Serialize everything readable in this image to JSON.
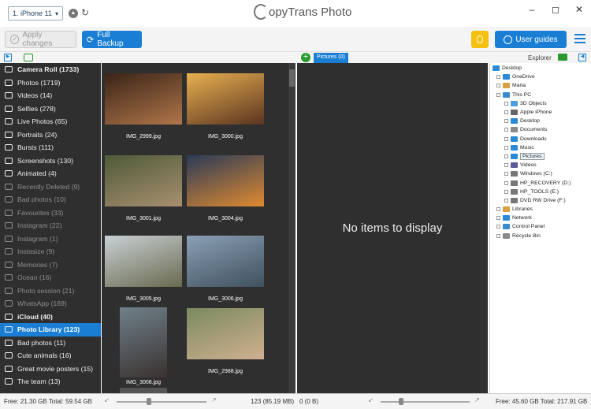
{
  "device": {
    "label": "1. iPhone 11"
  },
  "app": {
    "title_text": "opyTrans Photo"
  },
  "toolbar": {
    "apply_label": "Apply changes",
    "backup_label": "Full Backup",
    "guides_label": "User guides"
  },
  "panels": {
    "pictures_tab": "Pictures (0)",
    "explorer_label": "Explorer"
  },
  "sidebar": {
    "items": [
      {
        "label": "Camera Roll (1733)",
        "kind": "header"
      },
      {
        "label": "Photos (1719)",
        "kind": "normal"
      },
      {
        "label": "Videos (14)",
        "kind": "normal"
      },
      {
        "label": "Selfies (278)",
        "kind": "normal"
      },
      {
        "label": "Live Photos (65)",
        "kind": "normal"
      },
      {
        "label": "Portraits (24)",
        "kind": "normal"
      },
      {
        "label": "Bursts (111)",
        "kind": "normal"
      },
      {
        "label": "Screenshots (130)",
        "kind": "normal"
      },
      {
        "label": "Animated (4)",
        "kind": "normal"
      },
      {
        "label": "Recently Deleted (9)",
        "kind": "dim"
      },
      {
        "label": "Bad photos (10)",
        "kind": "dim"
      },
      {
        "label": "Favourites (33)",
        "kind": "dim"
      },
      {
        "label": "Instagram (22)",
        "kind": "dim"
      },
      {
        "label": "Instagram (1)",
        "kind": "dim"
      },
      {
        "label": "Instasize (9)",
        "kind": "dim"
      },
      {
        "label": "Memories (7)",
        "kind": "dim"
      },
      {
        "label": "Ocean (16)",
        "kind": "dim"
      },
      {
        "label": "Photo session (21)",
        "kind": "dim"
      },
      {
        "label": "WhatsApp (169)",
        "kind": "dim"
      },
      {
        "label": "iCloud (40)",
        "kind": "header"
      },
      {
        "label": "Photo Library (123)",
        "kind": "selected"
      },
      {
        "label": "Bad photos (11)",
        "kind": "normal"
      },
      {
        "label": "Cute animals (16)",
        "kind": "normal"
      },
      {
        "label": "Great movie posters (15)",
        "kind": "normal"
      },
      {
        "label": "The team (13)",
        "kind": "normal"
      }
    ]
  },
  "photos": [
    {
      "name": "IMG_2999.jpg",
      "c1": "#3a2418",
      "c2": "#b0764a"
    },
    {
      "name": "IMG_3000.jpg",
      "c1": "#e8b050",
      "c2": "#5a3420"
    },
    {
      "name": "IMG_3001.jpg",
      "c1": "#4e5a38",
      "c2": "#a89070"
    },
    {
      "name": "IMG_3004.jpg",
      "c1": "#2a3a58",
      "c2": "#e08a30"
    },
    {
      "name": "IMG_3005.jpg",
      "c1": "#c8d0d4",
      "c2": "#6a6a50"
    },
    {
      "name": "IMG_3006.jpg",
      "c1": "#8aa0b4",
      "c2": "#40505e"
    },
    {
      "name": "IMG_3008.jpg",
      "c1": "#70808a",
      "c2": "#3a3230"
    },
    {
      "name": "IMG_2988.jpg",
      "c1": "#7a8a60",
      "c2": "#d0b090"
    }
  ],
  "center": {
    "empty_text": "No items to display"
  },
  "explorer": {
    "nodes": [
      {
        "label": "Desktop",
        "level": 0,
        "icon": "desktop-icon",
        "color": "#2a8ad8"
      },
      {
        "label": "OneDrive",
        "level": 1,
        "icon": "cloud-icon",
        "color": "#2a8ad8"
      },
      {
        "label": "Maria",
        "level": 1,
        "icon": "user-icon",
        "color": "#d8a040"
      },
      {
        "label": "This PC",
        "level": 1,
        "icon": "computer-icon",
        "color": "#3a8ad0"
      },
      {
        "label": "3D Objects",
        "level": 2,
        "icon": "cube-icon",
        "color": "#4aa0e0"
      },
      {
        "label": "Apple iPhone",
        "level": 2,
        "icon": "phone-icon",
        "color": "#666666"
      },
      {
        "label": "Desktop",
        "level": 2,
        "icon": "desktop-icon",
        "color": "#2a8ad8"
      },
      {
        "label": "Documents",
        "level": 2,
        "icon": "document-icon",
        "color": "#8a8a8a"
      },
      {
        "label": "Downloads",
        "level": 2,
        "icon": "download-icon",
        "color": "#2a8ad8"
      },
      {
        "label": "Music",
        "level": 2,
        "icon": "music-icon",
        "color": "#2a8ad8"
      },
      {
        "label": "Pictures",
        "level": 2,
        "icon": "picture-icon",
        "color": "#2a8ad8",
        "selected": true
      },
      {
        "label": "Videos",
        "level": 2,
        "icon": "video-icon",
        "color": "#5a5a9a"
      },
      {
        "label": "Windows (C:)",
        "level": 2,
        "icon": "drive-icon",
        "color": "#777777"
      },
      {
        "label": "HP_RECOVERY (D:)",
        "level": 2,
        "icon": "drive-icon",
        "color": "#777777"
      },
      {
        "label": "HP_TOOLS (E:)",
        "level": 2,
        "icon": "drive-icon",
        "color": "#777777"
      },
      {
        "label": "DVD RW Drive (F:)",
        "level": 2,
        "icon": "dvd-icon",
        "color": "#777777"
      },
      {
        "label": "Libraries",
        "level": 1,
        "icon": "library-icon",
        "color": "#d8a040"
      },
      {
        "label": "Network",
        "level": 1,
        "icon": "network-icon",
        "color": "#2a8ad8"
      },
      {
        "label": "Control Panel",
        "level": 1,
        "icon": "control-panel-icon",
        "color": "#3a8ad0"
      },
      {
        "label": "Recycle Bin",
        "level": 1,
        "icon": "recycle-bin-icon",
        "color": "#8a8a8a"
      }
    ]
  },
  "status": {
    "left": "Free: 21.30 GB Total: 59.54 GB",
    "grid_count": "123 (85.19 MB)",
    "center_count": "0 (0 B)",
    "right": "Free: 45.60 GB Total: 217.91 GB"
  },
  "colors": {
    "accent": "#1a7fd4",
    "dark_panel": "#2f2f2f",
    "bulb": "#f4c20d"
  }
}
